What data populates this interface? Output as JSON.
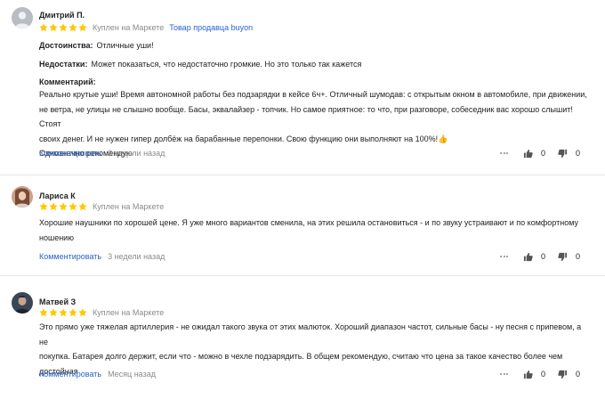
{
  "colors": {
    "star": "#ffc800",
    "link": "#2a62c9",
    "muted": "#8a8a8a",
    "icon": "#555555"
  },
  "reviews": [
    {
      "author": "Дмитрий П.",
      "rating": 5,
      "bought": "Куплен на Маркете",
      "seller_link": "Товар продавца buyon",
      "pros_label": "Достоинства:",
      "pros": "Отличные уши!",
      "cons_label": "Недостатки:",
      "cons": "Может показаться, что недостаточно громкие. Но это только так кажется",
      "comment_label": "Комментарий:",
      "comment_lines": [
        "Реально крутые уши! Время автономной работы без подзарядки в кейсе 6ч+. Отличный шумодав: с открытым окном в автомобиле, при движении,",
        "не ветра, не улицы не слышно вообще. Басы, эквалайзер - топчик. Но самое приятное: то что, при разговоре, собеседник вас хорошо слышит! Стоят",
        "своих денег. И не нужен гипер долбёж на барабанные перепонки. Свою функцию они выполняют на 100%!👍",
        "Однозначно рекомендую"
      ],
      "comment_action": "Комментировать",
      "date": "3 недели назад",
      "likes": "0",
      "dislikes": "0"
    },
    {
      "author": "Лариса К",
      "rating": 5,
      "bought": "Куплен на Маркете",
      "text_lines": [
        "Хорошие наушники по хорошей цене. Я уже много вариантов сменила, на этих решила остановиться - и по звуку устраивают и по комфортному",
        "ношению"
      ],
      "comment_action": "Комментировать",
      "date": "3 недели назад",
      "likes": "0",
      "dislikes": "0"
    },
    {
      "author": "Матвей З",
      "rating": 5,
      "bought": "Куплен на Маркете",
      "text_lines": [
        "Это прямо уже тяжелая артиллерия - не ожидал такого звука от этих малюток. Хороший диапазон частот, сильные басы - ну песня с припевом, а не",
        "покупка. Батарея долго держит, если что - можно в чехле подзарядить. В общем рекомендую, считаю что цена за такое качество более чем",
        "достойная"
      ],
      "comment_action": "Комментировать",
      "date": "Месяц назад",
      "likes": "0",
      "dislikes": "0"
    }
  ]
}
